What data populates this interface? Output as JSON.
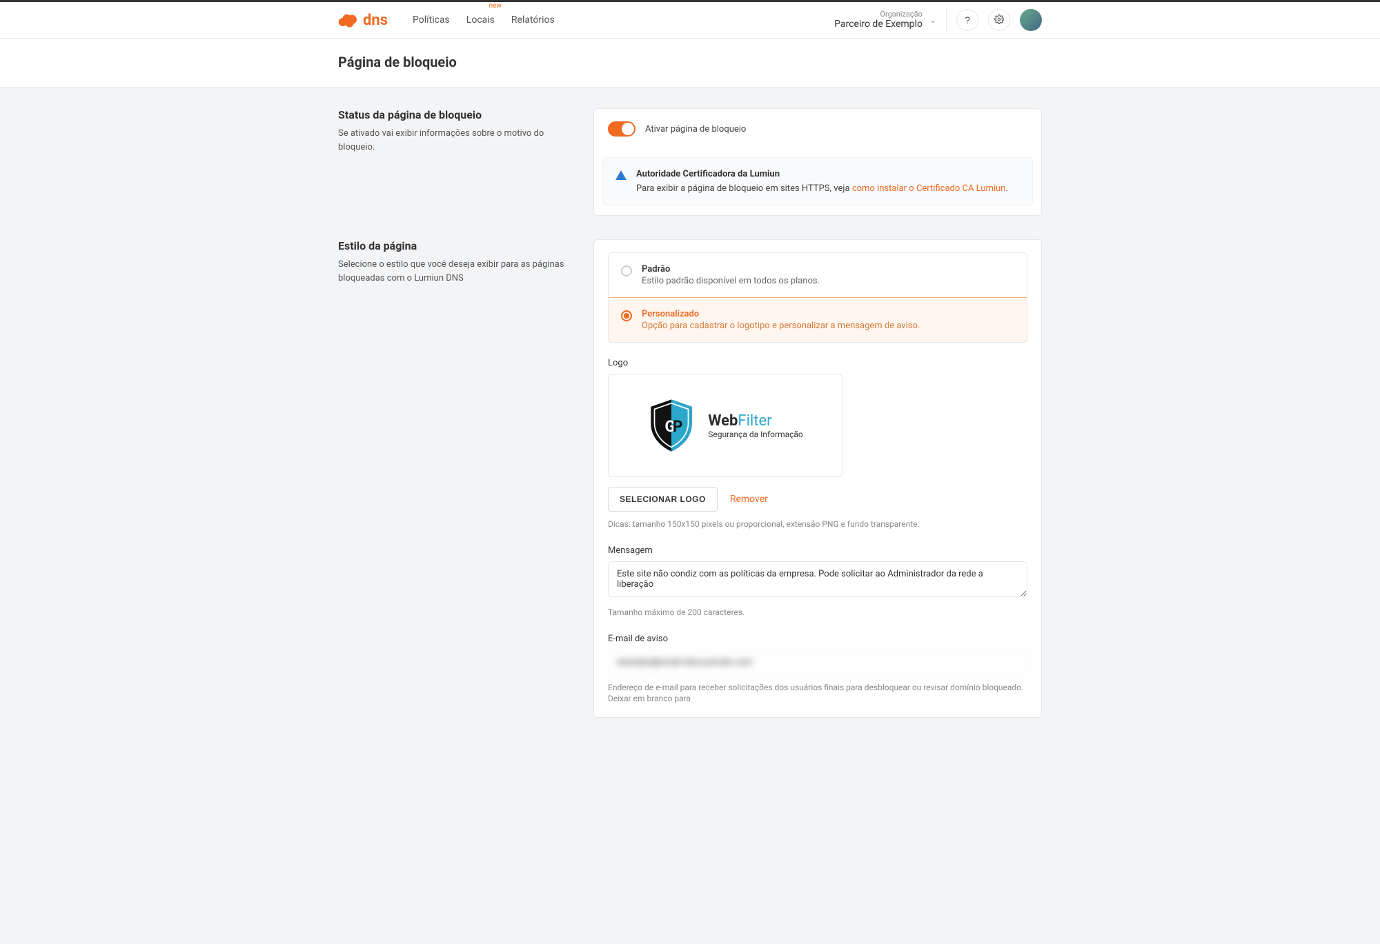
{
  "brand": {
    "name": "dns"
  },
  "nav": {
    "politicas": "Políticas",
    "locais": "Locais",
    "locais_badge": "new",
    "relatorios": "Relatórios"
  },
  "topright": {
    "org_label": "Organização",
    "org_value": "Parceiro de Exemplo"
  },
  "page_title": "Página de bloqueio",
  "status": {
    "heading": "Status da página de bloqueio",
    "description": "Se ativado vai exibir informações sobre o motivo do bloqueio.",
    "toggle_label": "Ativar página de bloqueio",
    "toggle_on": true,
    "alert_title": "Autoridade Certificadora da Lumiun",
    "alert_text": "Para exibir a página de bloqueio em sites HTTPS, veja ",
    "alert_link": "como instalar o Certificado CA Lumiun",
    "alert_tail": "."
  },
  "style": {
    "heading": "Estilo da página",
    "description": "Selecione o estilo que você deseja exibir para as páginas bloqueadas com o Lumiun DNS",
    "options": {
      "default_title": "Padrão",
      "default_sub": "Estilo padrão disponível em todos os planos.",
      "custom_title": "Personalizado",
      "custom_sub": "Opção para cadastrar o logotipo e personalizar a mensagem de aviso."
    },
    "logo": {
      "label": "Logo",
      "preview_brand": "Web",
      "preview_brand_accent": "Filter",
      "preview_tagline": "Segurança da Informação",
      "select_btn": "SELECIONAR LOGO",
      "remove_link": "Remover",
      "hint": "Dicas: tamanho 150x150 pixels ou proporcional, extensão PNG e fundo transparente."
    },
    "message": {
      "label": "Mensagem",
      "value": "Este site não condiz com as políticas da empresa. Pode solicitar ao Administrador da rede a liberação",
      "hint": "Tamanho máximo de 200 caracteres."
    },
    "email": {
      "label": "E-mail de aviso",
      "value": "exemplo@email-obscurecido.com",
      "hint": "Endereço de e-mail para receber solicitações dos usuários finais para desbloquear ou revisar domínio bloqueado. Deixar em branco para"
    }
  }
}
